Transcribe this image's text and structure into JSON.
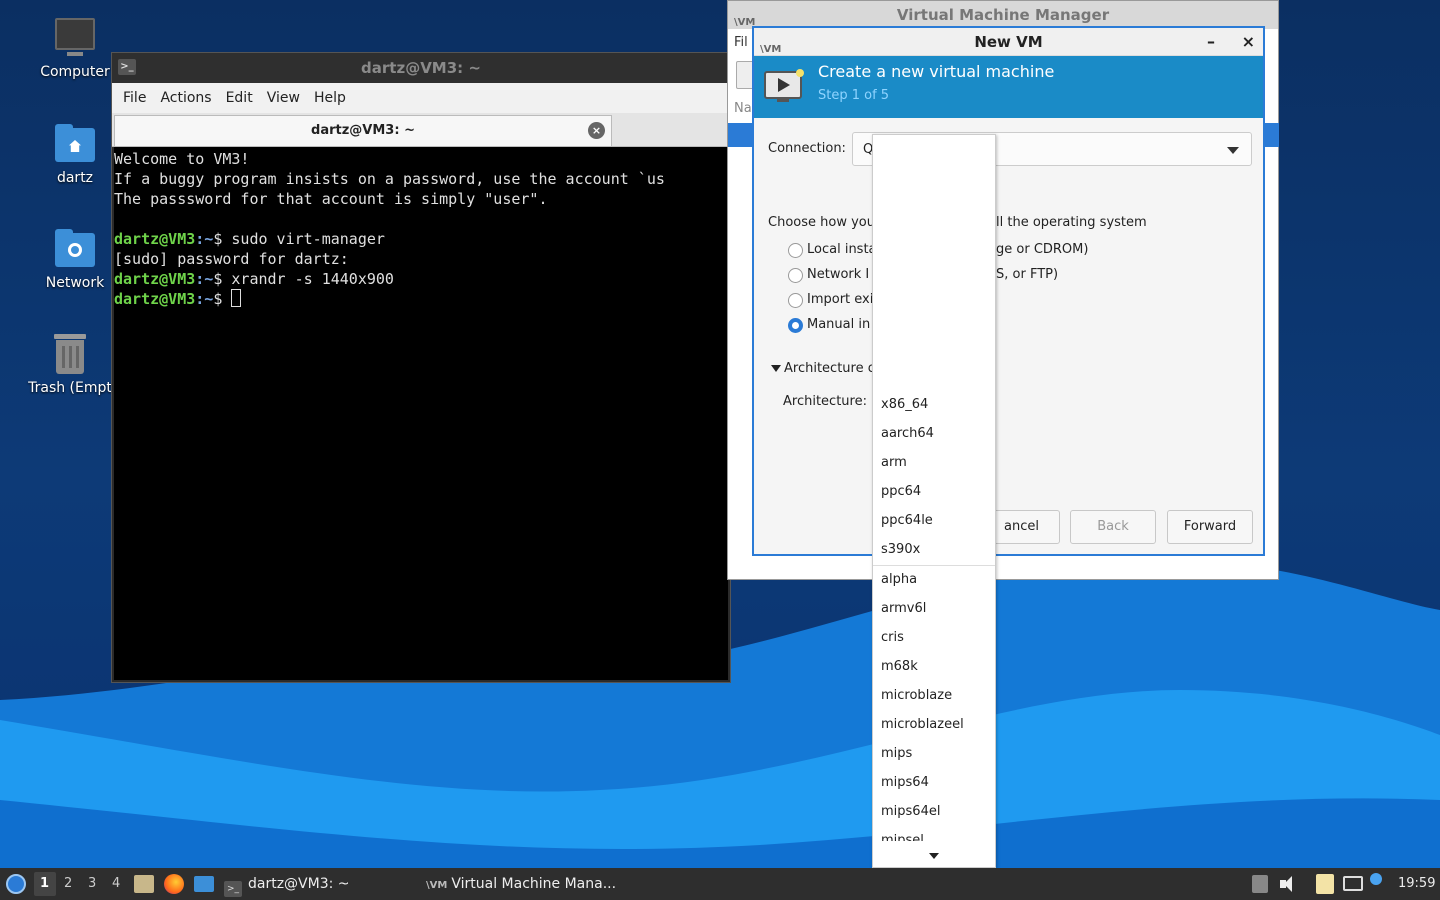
{
  "desktop": {
    "icons": [
      {
        "label": "Computer"
      },
      {
        "label": "dartz"
      },
      {
        "label": "Network"
      },
      {
        "label": "Trash (Empt"
      }
    ]
  },
  "terminal": {
    "title": "dartz@VM3: ~",
    "menu": [
      "File",
      "Actions",
      "Edit",
      "View",
      "Help"
    ],
    "tab_title": "dartz@VM3: ~",
    "tab_close": "×",
    "lines": [
      "Welcome to VM3!",
      "If a buggy program insists on a password, use the account `us",
      "The passsword for that account is simply \"user\"."
    ],
    "prompt_user": "dartz@VM3",
    "prompt_path": ":~",
    "prompt_dollar": "$",
    "commands": [
      "sudo virt-manager",
      "xrandr -s 1440x900",
      ""
    ],
    "sudo_line": "[sudo] password for dartz:"
  },
  "vmm": {
    "title": "Virtual Machine Manager",
    "icon_text": "\\VM",
    "menu_fragment": "Fil",
    "column_fragment": "Na"
  },
  "newvm": {
    "title": "New VM",
    "icon_text": "\\VM",
    "minimize": "–",
    "close": "×",
    "header_title": "Create a new virtual machine",
    "header_step": "Step 1 of 5",
    "connection_label": "Connection:",
    "connection_value": "Q",
    "choose_label_left": "Choose how you",
    "choose_label_right": "ll the operating system",
    "options": [
      {
        "left": "Local insta",
        "right": "ge or CDROM)",
        "selected": false
      },
      {
        "left": "Network I",
        "right": "S, or FTP)",
        "selected": false
      },
      {
        "left": "Import exi",
        "right": "",
        "selected": false
      },
      {
        "left": "Manual in",
        "right": "",
        "selected": true
      }
    ],
    "arch_expander": "Architecture o",
    "arch_label": "Architecture:",
    "buttons": {
      "cancel": "ancel",
      "back": "Back",
      "forward": "Forward"
    }
  },
  "dropdown": {
    "items": [
      "x86_64",
      "aarch64",
      "arm",
      "ppc64",
      "ppc64le",
      "s390x",
      "alpha",
      "armv6l",
      "cris",
      "m68k",
      "microblaze",
      "microblazeel",
      "mips",
      "mips64",
      "mips64el",
      "mipsel"
    ]
  },
  "taskbar": {
    "workspaces": [
      "1",
      "2",
      "3",
      "4"
    ],
    "active_workspace": "1",
    "tasks": [
      {
        "label": "dartz@VM3: ~"
      },
      {
        "label": "Virtual Machine Mana..."
      }
    ],
    "clock": "19:59"
  },
  "colors": {
    "accent": "#2b7bd6",
    "header": "#1a8bc7",
    "prompt_green": "#6fd34a",
    "prompt_blue": "#7aa5e0"
  }
}
